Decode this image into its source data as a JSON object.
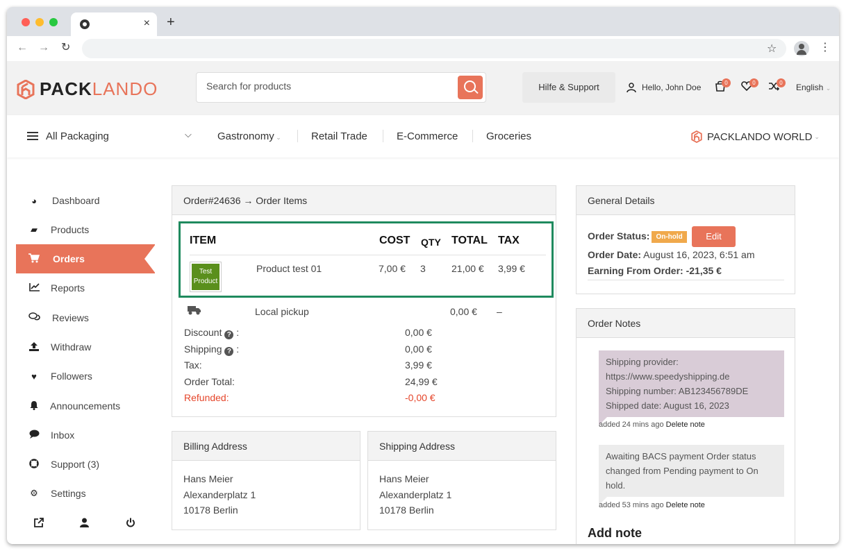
{
  "browser": {
    "tab_close": "×",
    "new_tab": "+",
    "back": "←",
    "forward": "→",
    "reload": "↻",
    "star": "☆",
    "menu": "⋮"
  },
  "header": {
    "logo_main": "PACK",
    "logo_accent": "LANDO",
    "search_placeholder": "Search for products",
    "help_label": "Hilfe & Support",
    "user_greeting": "Hello, John Doe",
    "cart_count": "0",
    "wishlist_count": "0",
    "compare_count": "0",
    "language": "English"
  },
  "catbar": {
    "all_label": "All Packaging",
    "categories": [
      "Gastronomy",
      "Retail Trade",
      "E-Commerce",
      "Groceries"
    ],
    "world_label": "PACKLANDO WORLD"
  },
  "sidebar": {
    "items": [
      {
        "label": "Dashboard",
        "icon": "dashboard-icon"
      },
      {
        "label": "Products",
        "icon": "briefcase-icon"
      },
      {
        "label": "Orders",
        "icon": "cart-icon"
      },
      {
        "label": "Reports",
        "icon": "chart-icon"
      },
      {
        "label": "Reviews",
        "icon": "comments-icon"
      },
      {
        "label": "Withdraw",
        "icon": "upload-icon"
      },
      {
        "label": "Followers",
        "icon": "heart-icon"
      },
      {
        "label": "Announcements",
        "icon": "bell-icon"
      },
      {
        "label": "Inbox",
        "icon": "chat-icon"
      },
      {
        "label": "Support (3)",
        "icon": "lifebuoy-icon"
      },
      {
        "label": "Settings",
        "icon": "gear-icon"
      }
    ],
    "active_index": 2
  },
  "order_items": {
    "title": "Order#24636 → Order Items",
    "columns": {
      "item": "ITEM",
      "cost": "COST",
      "qty": "QTY",
      "total": "TOTAL",
      "tax": "TAX"
    },
    "product": {
      "thumb_line1": "Test",
      "thumb_line2": "Product",
      "name": "Product test 01",
      "cost": "7,00 €",
      "qty": "3",
      "total": "21,00 €",
      "tax": "3,99 €"
    },
    "shipping_row": {
      "name": "Local pickup",
      "total": "0,00 €",
      "tax": "–"
    },
    "summary": {
      "discount_label": "Discount",
      "discount_value": "0,00 €",
      "shipping_label": "Shipping",
      "shipping_value": "0,00 €",
      "tax_label": "Tax:",
      "tax_value": "3,99 €",
      "total_label": "Order Total:",
      "total_value": "24,99 €",
      "refunded_label": "Refunded:",
      "refunded_value": "-0,00 €"
    }
  },
  "billing": {
    "title": "Billing Address",
    "name": "Hans Meier",
    "street": "Alexanderplatz 1",
    "city": "10178 Berlin"
  },
  "shipping": {
    "title": "Shipping Address",
    "name": "Hans Meier",
    "street": "Alexanderplatz 1",
    "city": "10178 Berlin"
  },
  "general": {
    "title": "General Details",
    "status_label": "Order Status:",
    "status_value": "On-hold",
    "edit_label": "Edit",
    "date_label": "Order Date:",
    "date_value": "August 16, 2023, 6:51 am",
    "earning_label": "Earning From Order:",
    "earning_value": "-21,35 €"
  },
  "notes": {
    "title": "Order Notes",
    "items": [
      {
        "lines": [
          "Shipping provider:",
          "https://www.speedyshipping.de",
          "Shipping number: AB123456789DE",
          "Shipped date: August 16, 2023"
        ],
        "meta": "added 24 mins ago",
        "delete": "Delete note"
      },
      {
        "lines": [
          "Awaiting BACS payment Order status",
          "changed from Pending payment to On",
          "hold."
        ],
        "meta": "added 53 mins ago",
        "delete": "Delete note"
      }
    ],
    "add_title": "Add note"
  },
  "colors": {
    "accent": "#e8745a",
    "highlight_border": "#1f8a5e",
    "onhold": "#f0a94c",
    "refund": "#e5452a"
  }
}
